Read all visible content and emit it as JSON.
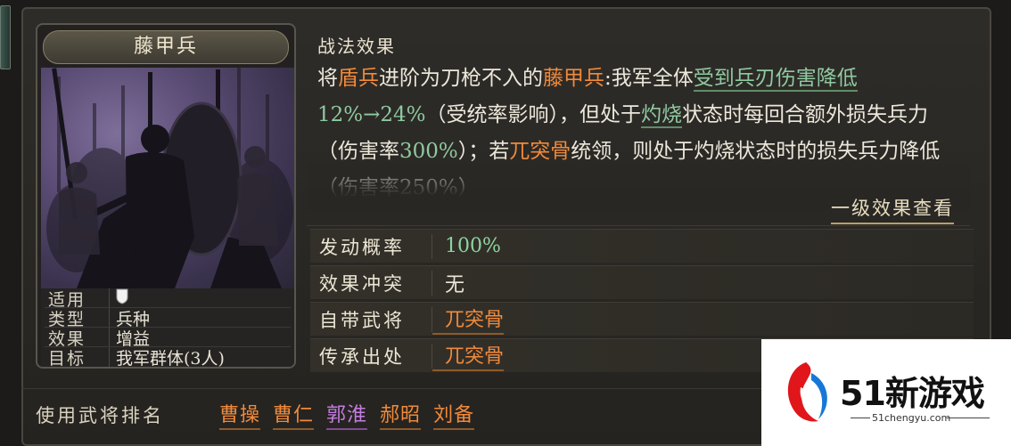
{
  "card": {
    "title": "藤甲兵",
    "info": [
      {
        "key": "适用",
        "value": ""
      },
      {
        "key": "类型",
        "value": "兵种"
      },
      {
        "key": "效果",
        "value": "增益"
      },
      {
        "key": "目标",
        "value": "我军群体(3人)"
      }
    ]
  },
  "description": {
    "heading": "战法效果",
    "segments": [
      {
        "t": "将",
        "s": ""
      },
      {
        "t": "盾兵",
        "s": "hl-orange"
      },
      {
        "t": "进阶为刀枪不入的",
        "s": ""
      },
      {
        "t": "藤甲兵",
        "s": "hl-orange"
      },
      {
        "t": ":我军全体",
        "s": ""
      },
      {
        "t": "受到兵刃伤害降低",
        "s": "ul-green"
      },
      {
        "t": "12%→24%",
        "s": "hl-green"
      },
      {
        "t": "（受统率影响），但处于",
        "s": ""
      },
      {
        "t": "灼烧",
        "s": "ul-green"
      },
      {
        "t": "状态时每回合额外损失兵力（伤害率",
        "s": ""
      },
      {
        "t": "300%",
        "s": "hl-green"
      },
      {
        "t": "）；若",
        "s": ""
      },
      {
        "t": "兀突骨",
        "s": "hl-orange"
      },
      {
        "t": "统领，则处于",
        "s": ""
      },
      {
        "t": "灼烧状态时的损失兵力降低（伤害率250%）",
        "s": ""
      }
    ],
    "view_link": "一级效果查看"
  },
  "attributes": [
    {
      "key": "发动概率",
      "value": "100%",
      "style": "v-green"
    },
    {
      "key": "效果冲突",
      "value": "无",
      "style": "v-white"
    },
    {
      "key": "自带武将",
      "value": "兀突骨",
      "style": "v-orange"
    },
    {
      "key": "传承出处",
      "value": "兀突骨",
      "style": "v-orange"
    }
  ],
  "ranking": {
    "label": "使用武将排名",
    "names": [
      "曹操",
      "曹仁",
      "郭淮",
      "郝昭",
      "刘备"
    ]
  },
  "watermark": {
    "brand": "51新游戏",
    "url": "51chengyu.com"
  },
  "colors": {
    "accent_orange": "#f08a3c",
    "accent_green": "#8fc9a0",
    "accent_purple": "#c47de0",
    "panel_bg": "#2b2925"
  },
  "icons": [
    "shield-icon",
    "soldier-silhouette-art",
    "watermark-logo-icon"
  ]
}
